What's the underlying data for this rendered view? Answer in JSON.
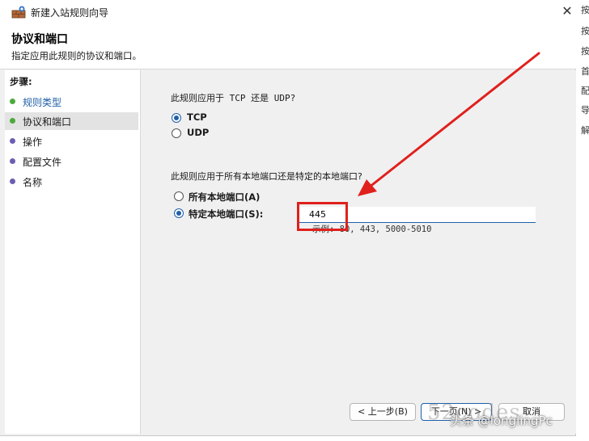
{
  "window": {
    "title": "新建入站规则向导",
    "close_glyph": "✕"
  },
  "header": {
    "title": "协议和端口",
    "subtitle": "指定应用此规则的协议和端口。"
  },
  "steps": {
    "title": "步骤:",
    "items": [
      {
        "label": "规则类型",
        "state": "done"
      },
      {
        "label": "协议和端口",
        "state": "current"
      },
      {
        "label": "操作",
        "state": "pending"
      },
      {
        "label": "配置文件",
        "state": "pending"
      },
      {
        "label": "名称",
        "state": "pending"
      }
    ]
  },
  "protocol": {
    "question": "此规则应用于 TCP 还是 UDP?",
    "options": [
      {
        "label": "TCP",
        "selected": true
      },
      {
        "label": "UDP",
        "selected": false
      }
    ]
  },
  "ports": {
    "question": "此规则应用于所有本地端口还是特定的本地端口?",
    "options": [
      {
        "label": "所有本地端口(A)",
        "selected": false
      },
      {
        "label": "特定本地端口(S):",
        "selected": true
      }
    ],
    "value": "445",
    "example": "示例: 80, 443, 5000-5010"
  },
  "buttons": {
    "back": "< 上一步(B)",
    "next": "下一页(N) >",
    "cancel": "取消"
  },
  "right_strip": [
    "按",
    "按",
    "按",
    "首",
    "配",
    "导",
    "解"
  ],
  "watermark": {
    "text": "头条 @longlingPc"
  },
  "colors": {
    "accent": "#1f5fa8",
    "annotation_red": "#e0201c",
    "step_done_dot": "#4caa3c",
    "step_pending_dot": "#6b5fb3"
  }
}
